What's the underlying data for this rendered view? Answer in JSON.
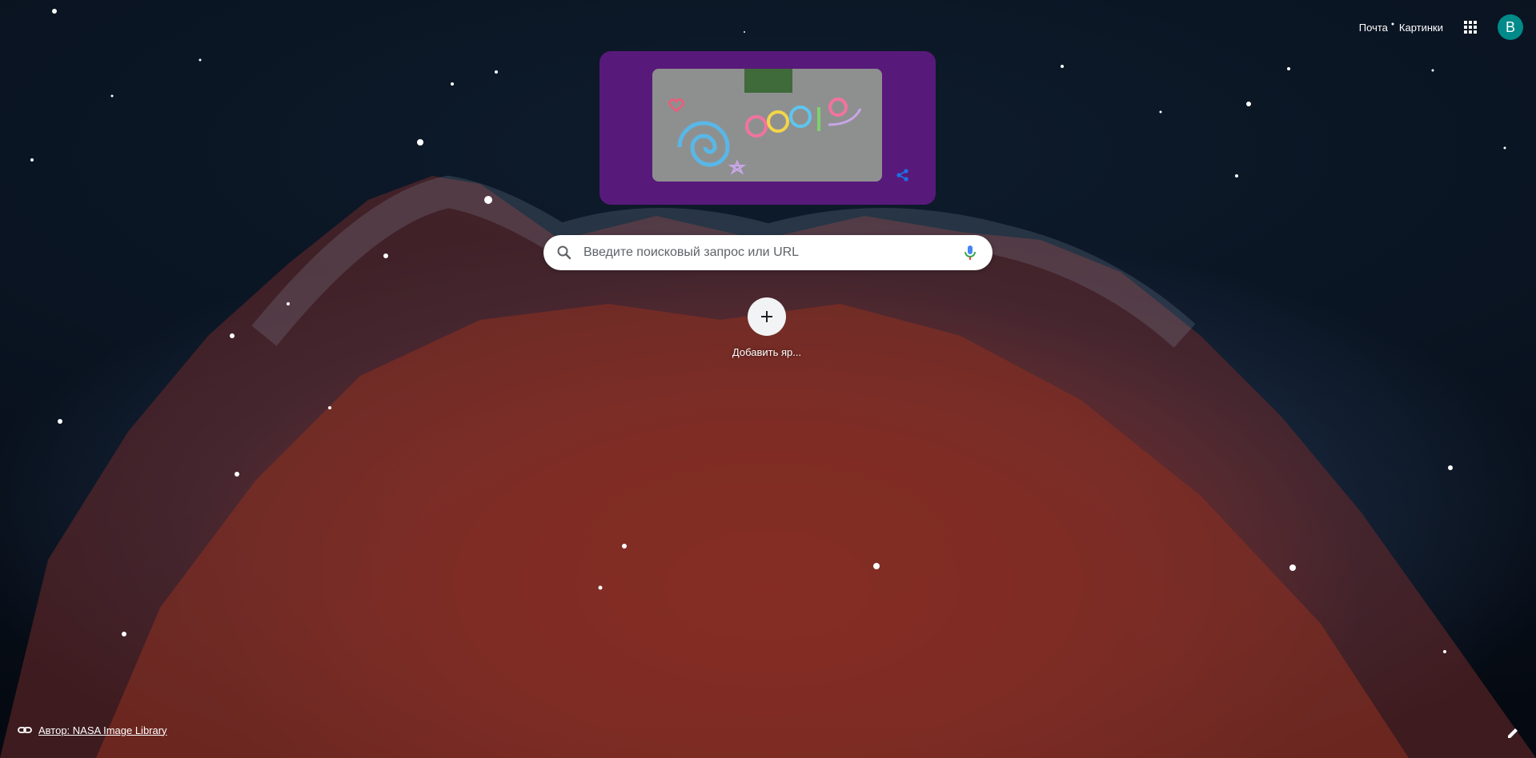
{
  "header": {
    "mail_label": "Почта",
    "images_label": "Картинки",
    "avatar_letter": "B",
    "avatar_color": "#008a8a"
  },
  "doodle": {
    "background_color": "#581a7a"
  },
  "search": {
    "placeholder": "Введите поисковый запрос или URL"
  },
  "shortcuts": {
    "add_label": "Добавить яр..."
  },
  "footer": {
    "attribution_text": "Автор: NASA Image Library"
  }
}
